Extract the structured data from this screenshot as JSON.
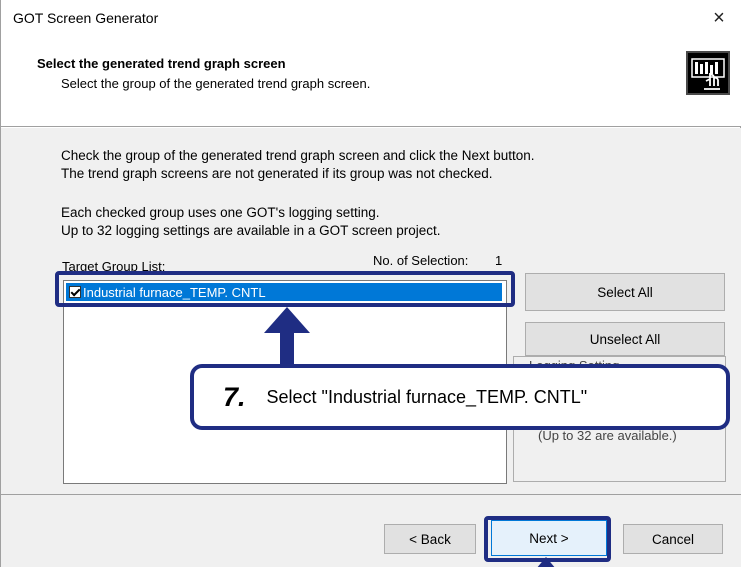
{
  "window": {
    "title": "GOT Screen Generator",
    "close_glyph": "×"
  },
  "header": {
    "title": "Select the generated trend graph screen",
    "subtitle": "Select the group of the generated trend graph screen.",
    "icon": "touch-panel-icon"
  },
  "body": {
    "desc_line1": "Check the group of the generated trend graph screen and click the Next button.",
    "desc_line2": "The trend graph screens are not generated if its group was not checked.",
    "desc_line3": "Each checked group uses one GOT's logging setting.",
    "desc_line4": "Up to 32 logging settings are available in a GOT screen project.",
    "target_group_label": "Target Group List:",
    "selection_label": "No. of Selection:",
    "selection_count": "1",
    "groups": [
      {
        "label": "Industrial furnace_TEMP. CNTL",
        "checked": true,
        "selected": true
      }
    ],
    "select_all_label": "Select All",
    "unselect_all_label": "Unselect All",
    "logging_partial": "Logging Setting",
    "available_note": "(Up to 32 are available.)"
  },
  "footer": {
    "back_label": "< Back",
    "next_label": "Next >",
    "cancel_label": "Cancel"
  },
  "annotation": {
    "step_number": "7.",
    "step_text": "Select \"Industrial furnace_TEMP. CNTL\"",
    "color": "#1f2d83"
  }
}
